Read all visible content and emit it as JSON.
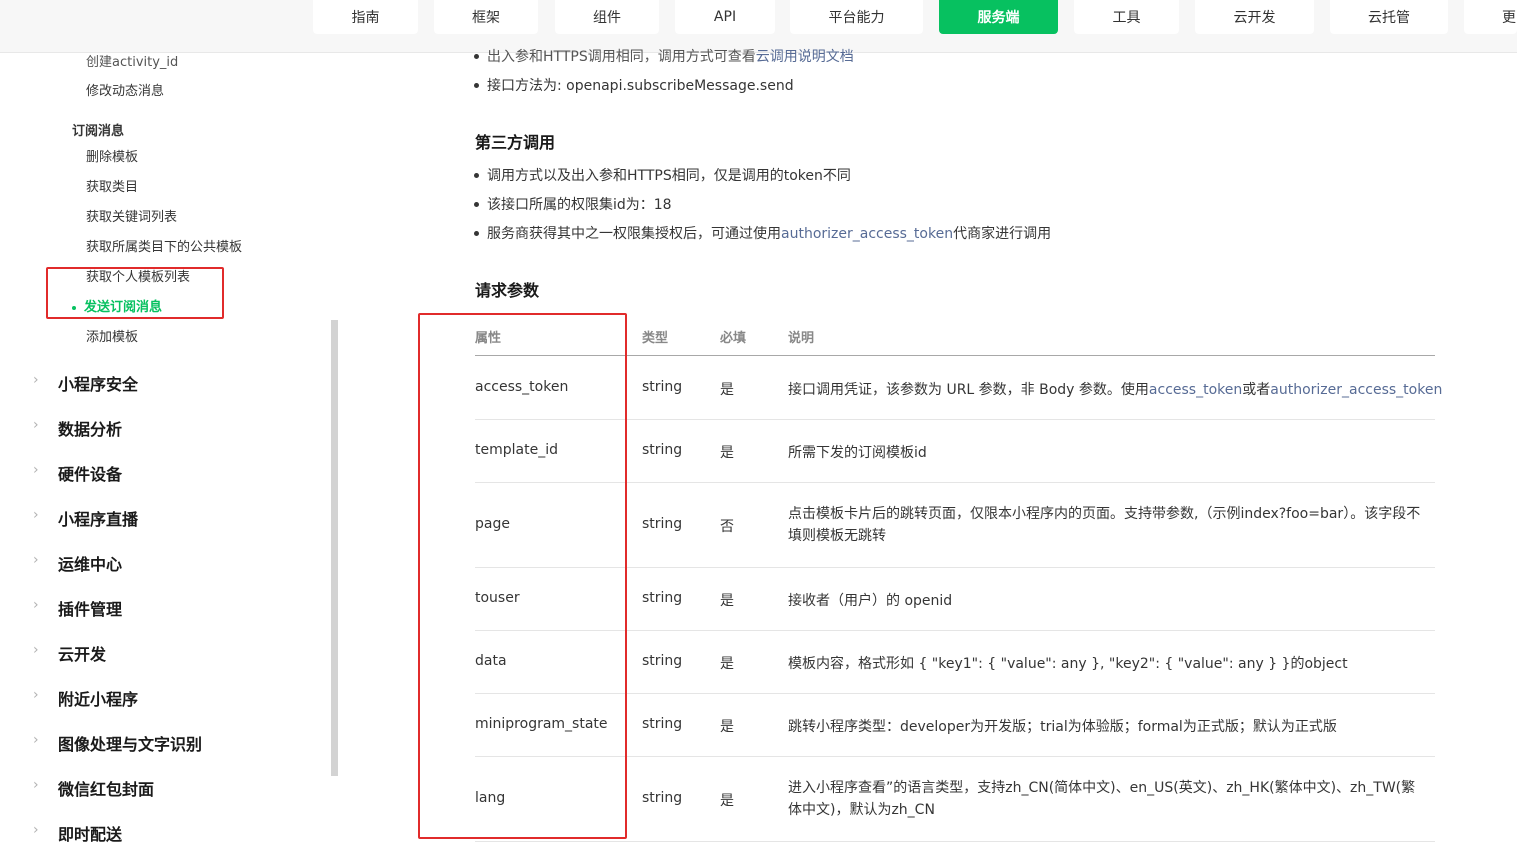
{
  "nav": {
    "tabs": [
      "指南",
      "框架",
      "组件",
      "API",
      "平台能力",
      "服务端",
      "工具",
      "云开发",
      "云托管",
      "更"
    ],
    "active": "服务端",
    "accent_color": "#07c160"
  },
  "sidebar": {
    "top_items": [
      "创建activity_id",
      "修改动态消息"
    ],
    "section_title": "订阅消息",
    "sub_items": [
      "删除模板",
      "获取类目",
      "获取关键词列表",
      "获取所属类目下的公共模板",
      "获取个人模板列表"
    ],
    "active_item": "发送订阅消息",
    "after_items": [
      "添加模板"
    ],
    "categories": [
      "小程序安全",
      "数据分析",
      "硬件设备",
      "小程序直播",
      "运维中心",
      "插件管理",
      "云开发",
      "附近小程序",
      "图像处理与文字识别",
      "微信红包封面",
      "即时配送"
    ]
  },
  "content": {
    "top_bullets": {
      "partial": "出入参和HTTPS调用相同，调用方式可查看",
      "partial_link": "云调用说明文档",
      "method": "接口方法为: openapi.subscribeMessage.send"
    },
    "third_party": {
      "title": "第三方调用",
      "b1": "调用方式以及出入参和HTTPS相同，仅是调用的token不同",
      "b2": "该接口所属的权限集id为：18",
      "b3_pre": "服务商获得其中之一权限集授权后，可通过使用",
      "b3_link": "authorizer_access_token",
      "b3_post": "代商家进行调用"
    },
    "params": {
      "title": "请求参数",
      "headers": [
        "属性",
        "类型",
        "必填",
        "说明"
      ],
      "rows": [
        {
          "name": "access_token",
          "type": "string",
          "required": "是",
          "desc_pre": "接口调用凭证，该参数为 URL 参数，非 Body 参数。使用",
          "link1": "access_token",
          "desc_mid": "或者",
          "link2": "authorizer_access_token"
        },
        {
          "name": "template_id",
          "type": "string",
          "required": "是",
          "desc": "所需下发的订阅模板id"
        },
        {
          "name": "page",
          "type": "string",
          "required": "否",
          "desc": "点击模板卡片后的跳转页面，仅限本小程序内的页面。支持带参数,（示例index?foo=bar）。该字段不填则模板无跳转"
        },
        {
          "name": "touser",
          "type": "string",
          "required": "是",
          "desc": "接收者（用户）的 openid"
        },
        {
          "name": "data",
          "type": "string",
          "required": "是",
          "desc": "模板内容，格式形如 { \"key1\": { \"value\": any }, \"key2\": { \"value\": any } }的object"
        },
        {
          "name": "miniprogram_state",
          "type": "string",
          "required": "是",
          "desc": "跳转小程序类型：developer为开发版；trial为体验版；formal为正式版；默认为正式版"
        },
        {
          "name": "lang",
          "type": "string",
          "required": "是",
          "desc": "进入小程序查看”的语言类型，支持zh_CN(简体中文)、en_US(英文)、zh_HK(繁体中文)、zh_TW(繁体中文)，默认为zh_CN"
        }
      ]
    }
  },
  "colors": {
    "highlight_box": "#e12b2b",
    "link": "#576b95"
  }
}
